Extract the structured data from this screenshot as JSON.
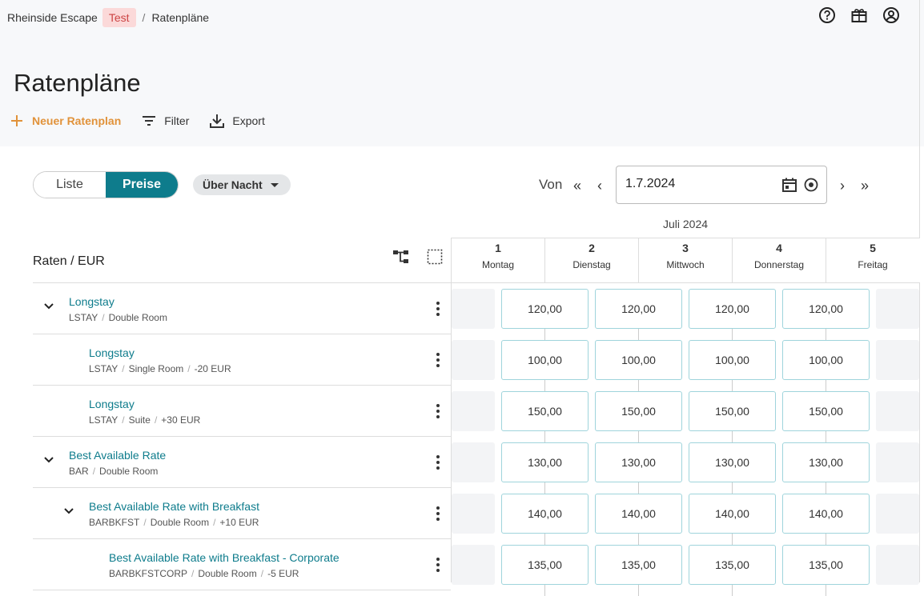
{
  "breadcrumb": {
    "property": "Rheinside Escape",
    "env": "Test",
    "sep": "/",
    "page": "Ratenpläne"
  },
  "page_title": "Ratenpläne",
  "actions": {
    "new": "Neuer Ratenplan",
    "filter": "Filter",
    "export": "Export"
  },
  "view_toggle": {
    "list": "Liste",
    "prices": "Preise"
  },
  "stay_type": "Über Nacht",
  "date": {
    "label": "Von",
    "value": "1.7.2024",
    "month": "Juli 2024"
  },
  "days": [
    {
      "num": "1",
      "name": "Montag"
    },
    {
      "num": "2",
      "name": "Dienstag"
    },
    {
      "num": "3",
      "name": "Mittwoch"
    },
    {
      "num": "4",
      "name": "Donnerstag"
    },
    {
      "num": "5",
      "name": "Freitag"
    }
  ],
  "rates_header": "Raten / EUR",
  "rates": [
    {
      "title": "Longstay",
      "code": "LSTAY",
      "room": "Double Room",
      "adj": "",
      "prices": [
        "120,00",
        "120,00",
        "120,00",
        "120,00"
      ]
    },
    {
      "title": "Longstay",
      "code": "LSTAY",
      "room": "Single Room",
      "adj": "-20 EUR",
      "prices": [
        "100,00",
        "100,00",
        "100,00",
        "100,00"
      ]
    },
    {
      "title": "Longstay",
      "code": "LSTAY",
      "room": "Suite",
      "adj": "+30 EUR",
      "prices": [
        "150,00",
        "150,00",
        "150,00",
        "150,00"
      ]
    },
    {
      "title": "Best Available Rate",
      "code": "BAR",
      "room": "Double Room",
      "adj": "",
      "prices": [
        "130,00",
        "130,00",
        "130,00",
        "130,00"
      ]
    },
    {
      "title": "Best Available Rate with Breakfast",
      "code": "BARBKFST",
      "room": "Double Room",
      "adj": "+10 EUR",
      "prices": [
        "140,00",
        "140,00",
        "140,00",
        "140,00"
      ]
    },
    {
      "title": "Best Available Rate with Breakfast - Corporate",
      "code": "BARBKFSTCORP",
      "room": "Double Room",
      "adj": "-5 EUR",
      "prices": [
        "135,00",
        "135,00",
        "135,00",
        "135,00"
      ]
    }
  ],
  "colors": {
    "accent": "#0e7c8c",
    "primary_action": "#e1923a",
    "cell_border": "#9fd4dc"
  }
}
